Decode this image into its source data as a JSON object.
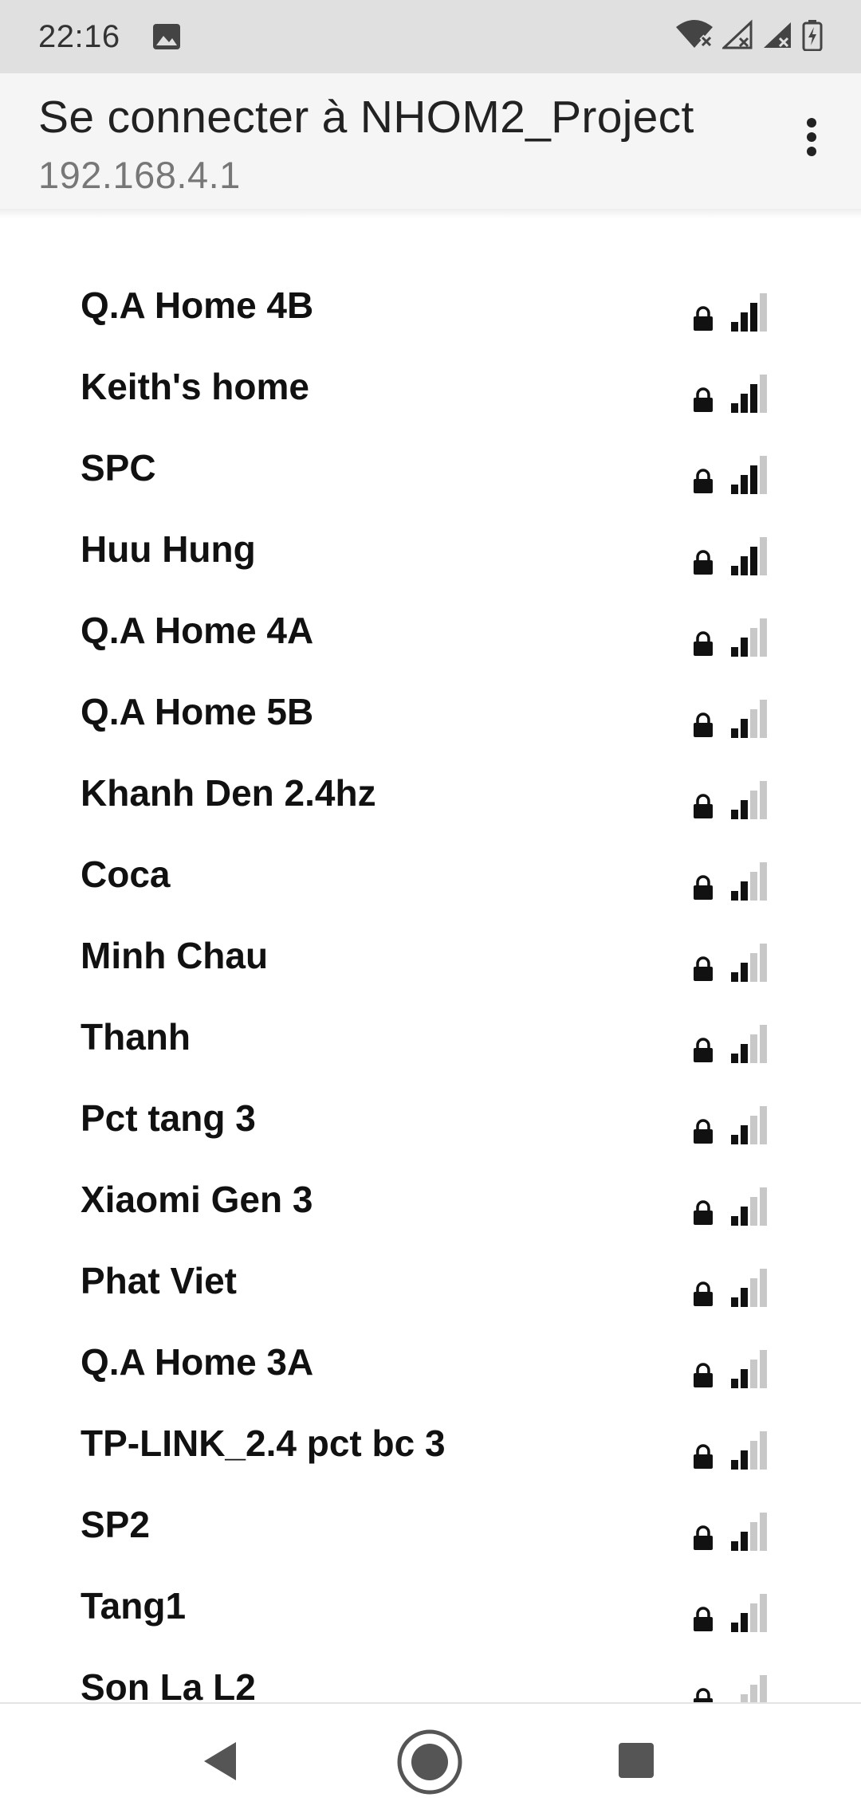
{
  "status_bar": {
    "time": "22:16",
    "icons": [
      "image-icon",
      "wifi-off-icon",
      "signal-no-data-icon",
      "signal-no-data-icon",
      "battery-charging-icon"
    ]
  },
  "header": {
    "title": "Se connecter à NHOM2_Project",
    "subtitle": "192.168.4.1",
    "menu_icon": "more-vert-icon"
  },
  "networks": [
    {
      "name": "Q.A Home 4B",
      "secured": true,
      "signal_bars": 3
    },
    {
      "name": "Keith's home",
      "secured": true,
      "signal_bars": 3
    },
    {
      "name": "SPC",
      "secured": true,
      "signal_bars": 3
    },
    {
      "name": "Huu Hung",
      "secured": true,
      "signal_bars": 3
    },
    {
      "name": "Q.A Home 4A",
      "secured": true,
      "signal_bars": 2
    },
    {
      "name": "Q.A Home 5B",
      "secured": true,
      "signal_bars": 2
    },
    {
      "name": "Khanh Den 2.4hz",
      "secured": true,
      "signal_bars": 2
    },
    {
      "name": "Coca",
      "secured": true,
      "signal_bars": 2
    },
    {
      "name": "Minh Chau",
      "secured": true,
      "signal_bars": 2
    },
    {
      "name": "Thanh",
      "secured": true,
      "signal_bars": 2
    },
    {
      "name": "Pct tang 3",
      "secured": true,
      "signal_bars": 2
    },
    {
      "name": "Xiaomi Gen 3",
      "secured": true,
      "signal_bars": 2
    },
    {
      "name": "Phat Viet",
      "secured": true,
      "signal_bars": 2
    },
    {
      "name": "Q.A Home 3A",
      "secured": true,
      "signal_bars": 2
    },
    {
      "name": "TP-LINK_2.4 pct bc 3",
      "secured": true,
      "signal_bars": 2
    },
    {
      "name": "SP2",
      "secured": true,
      "signal_bars": 2
    },
    {
      "name": "Tang1",
      "secured": true,
      "signal_bars": 2
    },
    {
      "name": "Son La L2",
      "secured": true,
      "signal_bars": 1
    }
  ],
  "signal_max_bars": 4,
  "nav_bar": {
    "icons": [
      "back-icon",
      "home-icon",
      "recents-icon"
    ]
  },
  "colors": {
    "status_bar_bg": "#e0e0e0",
    "header_bg": "#f5f5f5",
    "signal_active": "#111111",
    "signal_inactive": "#c8c8c8",
    "nav_icon": "#555555"
  }
}
